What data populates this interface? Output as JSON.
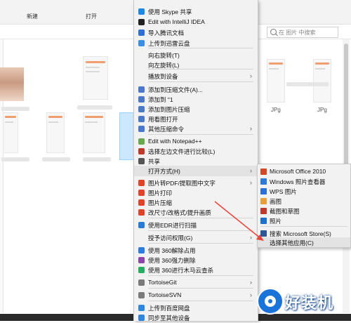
{
  "explorer": {
    "tabs": [
      "新建",
      "打开"
    ],
    "search_placeholder": "在 图片 中搜索",
    "file_labels": [
      "JPg",
      "JPg"
    ]
  },
  "context_menu": {
    "items": [
      {
        "label": "使用 Skype 共享",
        "icon": "skype-icon",
        "color": "#1e88e5"
      },
      {
        "label": "Edit with IntelliJ IDEA",
        "icon": "intellij-icon",
        "color": "#222222"
      },
      {
        "label": "导入腾讯文档",
        "icon": "tencent-docs-icon",
        "color": "#2f6fd6"
      },
      {
        "label": "上传到迅雷云盘",
        "icon": "xunlei-cloud-icon",
        "color": "#3a8ee6"
      },
      {
        "label": "向右旋转(T)",
        "icon": "",
        "color": ""
      },
      {
        "label": "向左旋转(L)",
        "icon": "",
        "color": ""
      },
      {
        "label": "播放到设备",
        "icon": "",
        "color": "",
        "submenu": true
      },
      {
        "label": "添加到压缩文件(A)...",
        "icon": "archive-icon",
        "color": "#4a79c9"
      },
      {
        "label": "添加到 \"1",
        "icon": "archive-icon",
        "color": "#4a79c9"
      },
      {
        "label": "添加到图片压缩",
        "icon": "archive-icon",
        "color": "#4a79c9"
      },
      {
        "label": "用看图打开",
        "icon": "viewer-icon",
        "color": "#4a79c9"
      },
      {
        "label": "其他压缩命令",
        "icon": "archive-icon",
        "color": "#4a79c9",
        "submenu": true
      },
      {
        "label": "Edit with Notepad++",
        "icon": "notepad-plus-icon",
        "color": "#6aa84f"
      },
      {
        "label": "选择左边文件进行比较(L)",
        "icon": "compare-icon",
        "color": "#c0392b"
      },
      {
        "label": "共享",
        "icon": "share-icon",
        "color": "#555555"
      },
      {
        "label": "打开方式(H)",
        "icon": "",
        "color": "",
        "submenu": true
      },
      {
        "label": "图片转PDF/提取图中文字",
        "icon": "wps-tool-icon",
        "color": "#e0432a",
        "submenu": true
      },
      {
        "label": "图片打印",
        "icon": "wps-tool-icon",
        "color": "#e0432a"
      },
      {
        "label": "图片压缩",
        "icon": "wps-tool-icon",
        "color": "#e0432a"
      },
      {
        "label": "改尺寸/改格式/提升画质",
        "icon": "wps-tool-icon",
        "color": "#e0432a"
      },
      {
        "label": "使用EDR进行扫描",
        "icon": "edr-scan-icon",
        "color": "#2a7ad8"
      },
      {
        "label": "授予访问权限(G)",
        "icon": "",
        "color": "",
        "submenu": true
      },
      {
        "label": "使用 360解除占用",
        "icon": "360-unlock-icon",
        "color": "#2b7de1"
      },
      {
        "label": "使用 360强力删除",
        "icon": "360-delete-icon",
        "color": "#8e44ad"
      },
      {
        "label": "使用 360进行木马云查杀",
        "icon": "360-scan-icon",
        "color": "#27ae60"
      },
      {
        "label": "TortoiseGit",
        "icon": "tortoisegit-icon",
        "color": "#7a7a7a",
        "submenu": true
      },
      {
        "label": "TortoiseSVN",
        "icon": "tortoisesvn-icon",
        "color": "#7a7a7a",
        "submenu": true
      },
      {
        "label": "上传到百度网盘",
        "icon": "baidu-pan-icon",
        "color": "#2e86de"
      },
      {
        "label": "同步至其他设备",
        "icon": "sync-icon",
        "color": "#2e86de"
      }
    ]
  },
  "open_with_submenu": {
    "items": [
      {
        "label": "Microsoft Office 2010",
        "icon": "office-icon",
        "color": "#d24726"
      },
      {
        "label": "Windows 照片查看器",
        "icon": "photo-viewer-icon",
        "color": "#2f7ad8"
      },
      {
        "label": "WPS 图片",
        "icon": "wps-picture-icon",
        "color": "#2a6fd6"
      },
      {
        "label": "画图",
        "icon": "paint-icon",
        "color": "#e8a13a"
      },
      {
        "label": "截图和草图",
        "icon": "snip-sketch-icon",
        "color": "#c0392b"
      },
      {
        "label": "照片",
        "icon": "photos-icon",
        "color": "#1f6fcf"
      },
      {
        "label": "搜索 Microsoft Store(S)",
        "icon": "store-icon",
        "color": "#2b5797"
      },
      {
        "label": "选择其他应用(C)",
        "icon": "",
        "color": ""
      }
    ]
  },
  "watermark": {
    "text": "好装机"
  }
}
